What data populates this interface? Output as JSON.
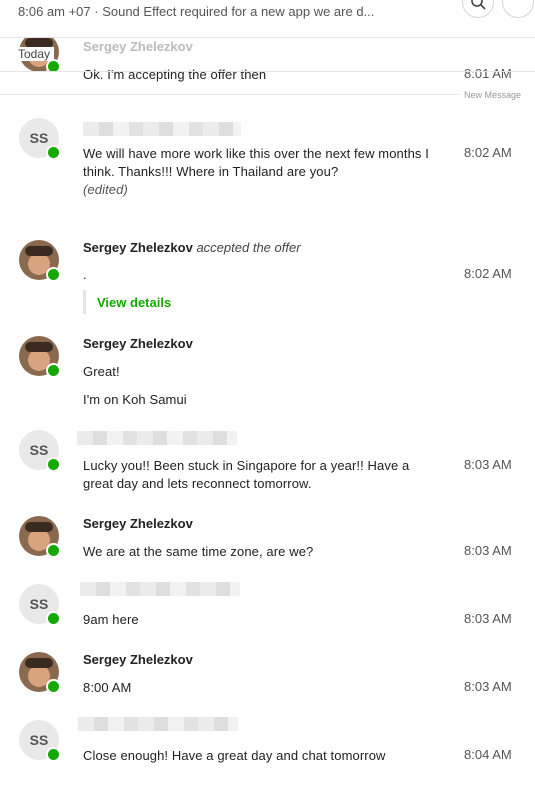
{
  "header": {
    "subtitle": "8:06 am +07 · Sound Effect required for a new app we are d..."
  },
  "divider": {
    "today": "Today",
    "new_message": "New Message"
  },
  "sender_name": "Sergey Zhelezkov",
  "my_initials": "SS",
  "colors": {
    "presence": "#14a800",
    "link": "#14a800"
  },
  "messages": [
    {
      "text": "Ok. I'm accepting the offer then",
      "time": "8:01 AM"
    },
    {
      "text": "We will have more work like this over the next few months I think. Thanks!!! Where in Thailand are you?",
      "edited": "(edited)",
      "time": "8:02 AM"
    },
    {
      "action": "accepted the offer",
      "text": ".",
      "link": "View details",
      "time": "8:02 AM"
    },
    {
      "lines": [
        "Great!",
        "I'm on Koh Samui"
      ]
    },
    {
      "text": "Lucky you!! Been stuck in Singapore for a year!! Have a great day and lets reconnect tomorrow.",
      "time": "8:03 AM"
    },
    {
      "text": "We are at the same time zone, are we?",
      "time": "8:03 AM"
    },
    {
      "text": "9am here",
      "time": "8:03 AM"
    },
    {
      "text": "8:00 AM",
      "time": "8:03 AM"
    },
    {
      "text": "Close enough! Have a great day and chat tomorrow",
      "time": "8:04 AM"
    }
  ]
}
